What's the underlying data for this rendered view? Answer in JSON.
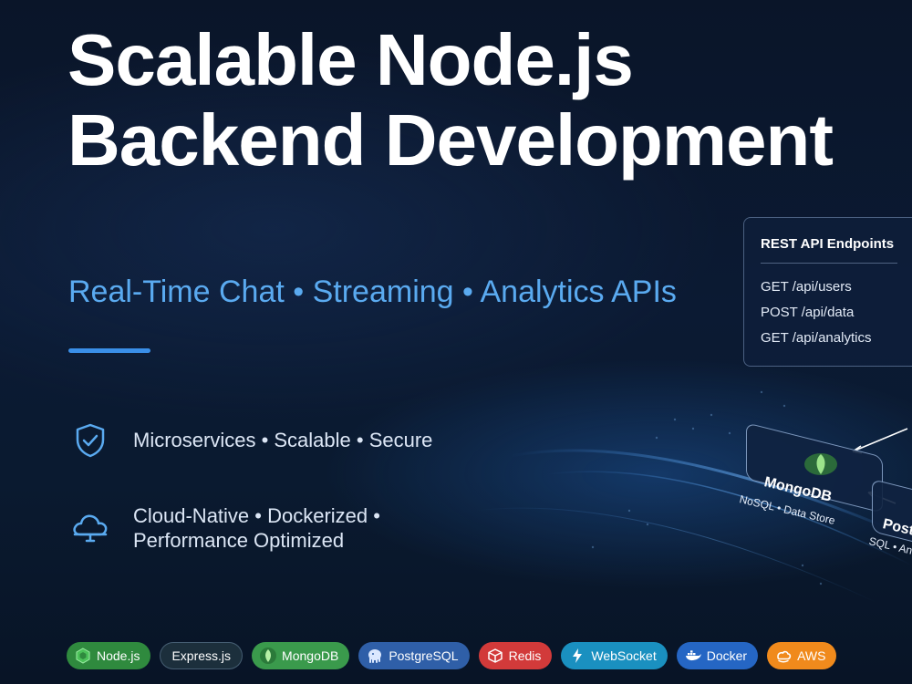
{
  "hero": {
    "title_line1": "Scalable Node.js",
    "title_line2": "Backend Development",
    "subtitle": "Real-Time Chat • Streaming • Analytics APIs"
  },
  "features": [
    {
      "icon": "shield-check-icon",
      "text": "Microservices • Scalable • Secure"
    },
    {
      "icon": "cloud-icon",
      "line1": "Cloud-Native • Dockerized •",
      "line2": "Performance Optimized"
    }
  ],
  "rest_card": {
    "title": "REST API Endpoints",
    "endpoints": [
      "GET /api/users",
      "POST /api/data",
      "GET /api/analytics"
    ]
  },
  "databases": {
    "mongo": {
      "name": "MongoDB",
      "subtitle": "NoSQL • Data Store"
    },
    "postgres": {
      "name": "Postg",
      "subtitle": "SQL • Ana"
    }
  },
  "tech_pills": [
    {
      "label": "Node.js",
      "icon": "nodejs-icon",
      "color": "#2f8a3e"
    },
    {
      "label": "Express.js",
      "icon": "",
      "color": "#1c2f3c"
    },
    {
      "label": "MongoDB",
      "icon": "leaf-icon",
      "color": "#3a9a4c"
    },
    {
      "label": "PostgreSQL",
      "icon": "elephant-icon",
      "color": "#2f5fa8"
    },
    {
      "label": "Redis",
      "icon": "cube-icon",
      "color": "#d23a3a"
    },
    {
      "label": "WebSocket",
      "icon": "bolt-icon",
      "color": "#1a90c0"
    },
    {
      "label": "Docker",
      "icon": "whale-icon",
      "color": "#2566c4"
    },
    {
      "label": "AWS",
      "icon": "aws-icon",
      "color": "#f08a1c"
    }
  ],
  "colors": {
    "accent_blue": "#3a8fe8",
    "subtitle_blue": "#5aaaf0",
    "background": "#0b1a33"
  }
}
